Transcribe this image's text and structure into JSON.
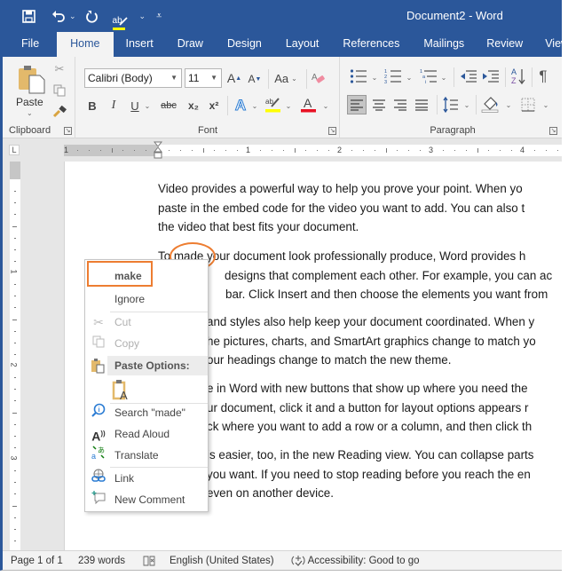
{
  "titlebar": {
    "title": "Document2  -  Word",
    "qat": {
      "save_icon": "💾",
      "undo_icon": "↶",
      "undo_caret": "⌄",
      "redo_icon": "↻",
      "spelling_icon": "ab✓",
      "spelling_caret": "⌄",
      "customize_icon": "⩡"
    }
  },
  "tabs": [
    {
      "label": "File"
    },
    {
      "label": "Home"
    },
    {
      "label": "Insert"
    },
    {
      "label": "Draw"
    },
    {
      "label": "Design"
    },
    {
      "label": "Layout"
    },
    {
      "label": "References"
    },
    {
      "label": "Mailings"
    },
    {
      "label": "Review"
    },
    {
      "label": "View"
    }
  ],
  "ribbon": {
    "clipboard": {
      "label": "Clipboard",
      "paste_label": "Paste",
      "paste_caret": "⌄"
    },
    "font": {
      "label": "Font",
      "font_name": "Calibri (Body)",
      "font_size": "11",
      "grow_font": "A",
      "shrink_font": "A",
      "change_case": "Aa",
      "bold": "B",
      "italic": "I",
      "underline": "U",
      "strikethrough": "abc",
      "subscript": "x₂",
      "superscript": "x²",
      "text_effects": "A",
      "highlight": "ab",
      "font_color": "A",
      "font_color_hex": "#e81123",
      "highlight_hex": "#ffff00"
    },
    "paragraph": {
      "label": "Paragraph",
      "pilcrow": "¶",
      "sort": "A↓"
    }
  },
  "ruler": {
    "corner": "L",
    "h_numbers": [
      "1",
      "1",
      "2",
      "3",
      "4"
    ],
    "v_numbers": [
      "1",
      "2",
      "3"
    ]
  },
  "document": {
    "paragraphs": [
      {
        "lines": [
          "Video provides a powerful way to help you prove your point. When yo",
          "paste in the embed code for the video you want to add. You can also t",
          "the video that best fits your document."
        ]
      },
      {
        "pre": "To ",
        "misspelled": "made",
        "post_first": " your document look professionally produce, Word provides h",
        "lines": [
          "designs that complement each other. For example, you can ac",
          "bar. Click Insert and then choose the elements you want from"
        ]
      },
      {
        "lines": [
          "and styles also help keep your document coordinated. When y",
          "he pictures, charts, and SmartArt graphics change to match yo",
          "our headings change to match the new theme."
        ]
      },
      {
        "lines": [
          "e in Word with new buttons that show up where you need the",
          "ur document, click it and a button for layout options appears r",
          "ck where you want to add a row or a column, and then click th"
        ]
      },
      {
        "lines": [
          "is easier, too, in the new Reading view. You can collapse parts",
          "you want. If you need to stop reading before you reach the en",
          "even on another device."
        ]
      }
    ]
  },
  "context_menu": {
    "suggestion": "make",
    "ignore": "Ignore",
    "cut": "Cut",
    "copy": "Copy",
    "paste_options": "Paste Options:",
    "search": "Search \"made\"",
    "read_aloud": "Read Aloud",
    "translate": "Translate",
    "link": "Link",
    "new_comment": "New Comment",
    "highlight_color": "#ed7d31"
  },
  "status_bar": {
    "page": "Page 1 of 1",
    "words": "239 words",
    "proofing_icon": "📖",
    "language": "English (United States)",
    "accessibility": "Accessibility: Good to go"
  }
}
